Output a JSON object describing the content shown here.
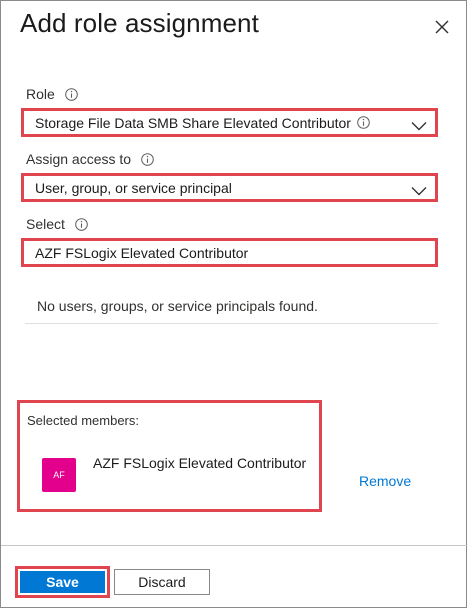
{
  "panel": {
    "title": "Add role assignment"
  },
  "role": {
    "label": "Role",
    "value": "Storage File Data SMB Share Elevated Contributor"
  },
  "assign_access": {
    "label": "Assign access to",
    "value": "User, group, or service principal"
  },
  "select": {
    "label": "Select",
    "value": "AZF FSLogix Elevated Contributor"
  },
  "results": {
    "empty_message": "No users, groups, or service principals found."
  },
  "selected_members": {
    "label": "Selected members:",
    "items": [
      {
        "initials": "AF",
        "name": "AZF FSLogix Elevated Contributor",
        "avatar_color": "#e3008c"
      }
    ],
    "remove_label": "Remove"
  },
  "footer": {
    "save_label": "Save",
    "discard_label": "Discard"
  },
  "colors": {
    "accent": "#0078d4",
    "highlight": "#e0444f"
  }
}
